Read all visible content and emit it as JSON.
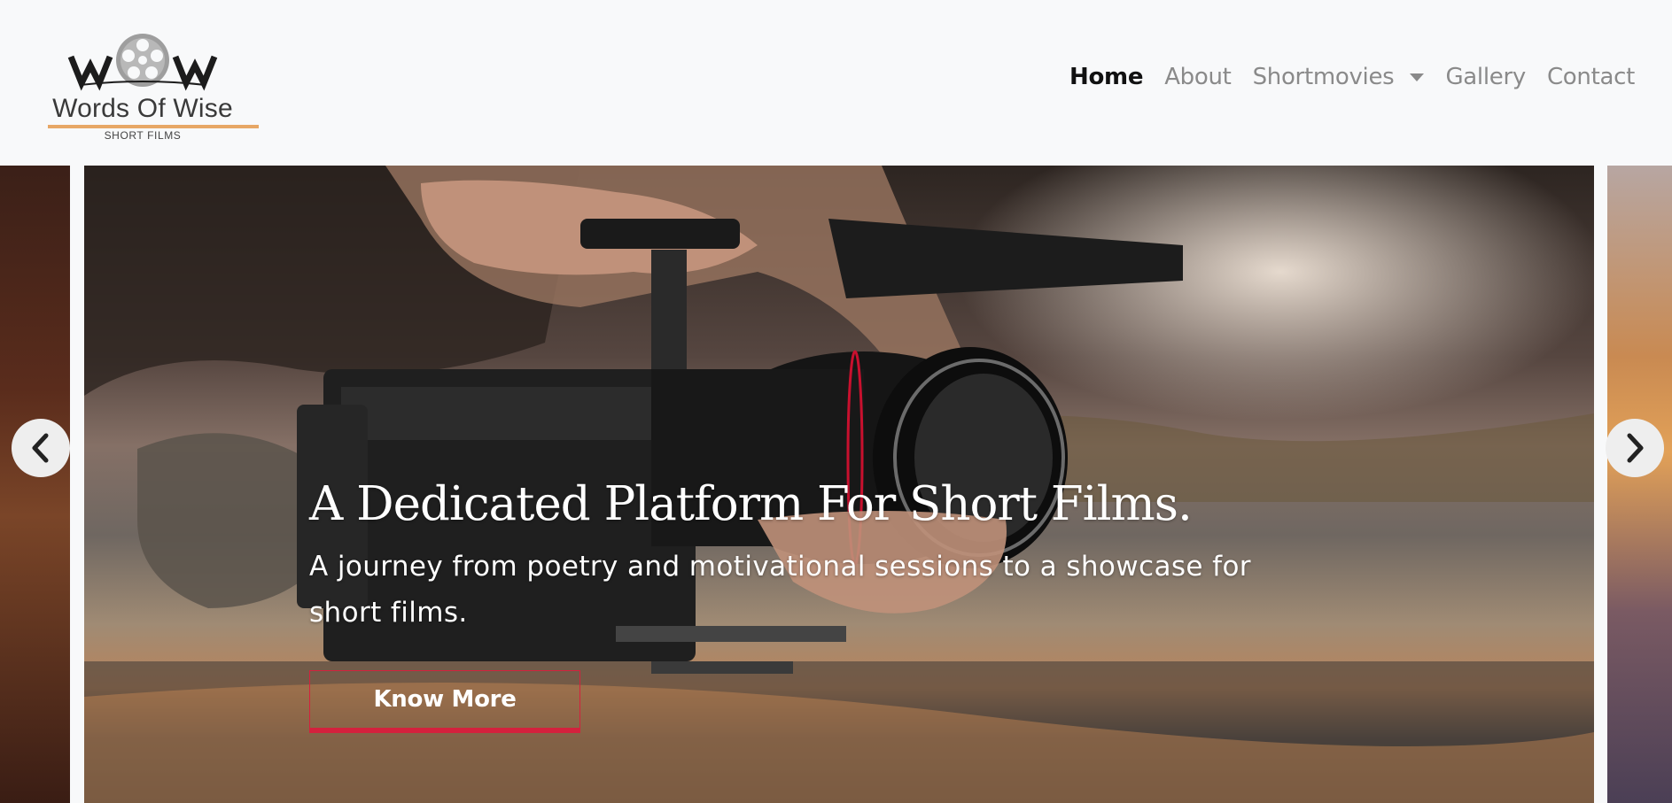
{
  "brand": {
    "name": "Words Of Wise",
    "subtitle": "SHORT FILMS",
    "logo_letters": "W  W",
    "logo_icon": "film-reel-icon"
  },
  "nav": {
    "items": [
      {
        "label": "Home",
        "active": true
      },
      {
        "label": "About",
        "active": false
      },
      {
        "label": "Shortmovies",
        "active": false,
        "dropdown": true
      },
      {
        "label": "Gallery",
        "active": false
      },
      {
        "label": "Contact",
        "active": false
      }
    ]
  },
  "hero": {
    "title": "A Dedicated Platform For Short Films.",
    "subtitle": "A journey from poetry and motivational sessions to a showcase for short films.",
    "button_label": "Know More"
  },
  "carousel": {
    "prev_icon": "chevron-left-icon",
    "next_icon": "chevron-right-icon"
  },
  "colors": {
    "accent": "#d4213d",
    "brand_rule": "#e7a766",
    "nav_active": "#111111",
    "nav_inactive": "#8a8a8a",
    "background": "#f8f9fa"
  }
}
